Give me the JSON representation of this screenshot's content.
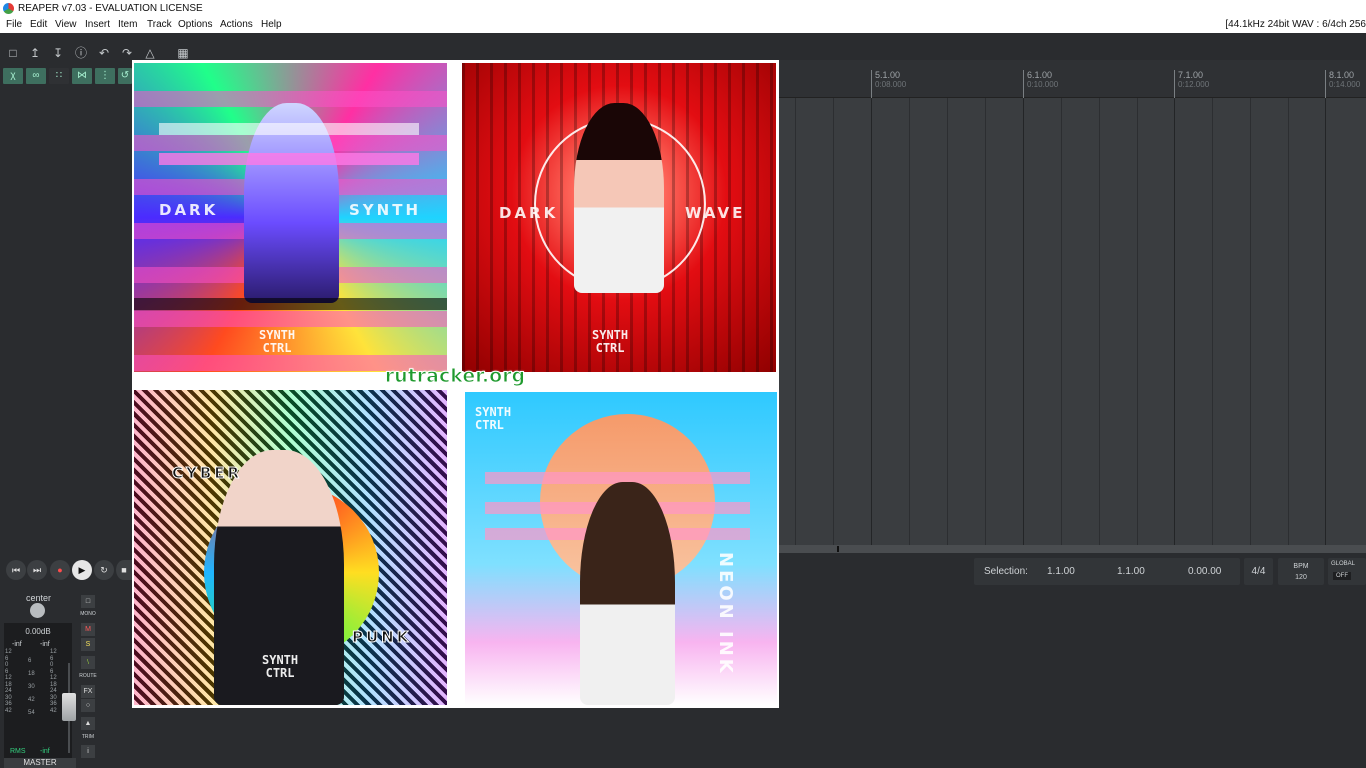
{
  "window": {
    "title": "REAPER v7.03 - EVALUATION LICENSE",
    "audio_status": "[44.1kHz 24bit WAV : 6/4ch 256"
  },
  "menu": [
    "File",
    "Edit",
    "View",
    "Insert",
    "Item",
    "Track",
    "Options",
    "Actions",
    "Help"
  ],
  "timeline": {
    "markers": [
      {
        "bar": "5.1.00",
        "time": "0:08.000"
      },
      {
        "bar": "6.1.00",
        "time": "0:10.000"
      },
      {
        "bar": "7.1.00",
        "time": "0:12.000"
      },
      {
        "bar": "8.1.00",
        "time": "0:14.000"
      }
    ]
  },
  "transport": {
    "selection_label": "Selection:",
    "selection_start": "1.1.00",
    "selection_end": "1.1.00",
    "selection_length": "0.00.00",
    "time_signature": "4/4",
    "bpm_label": "BPM",
    "bpm_value": "120",
    "global_label": "GLOBAL",
    "global_state": "OFF"
  },
  "master": {
    "pan": "center",
    "volume": "0.00dB",
    "peak_left": "-inf",
    "peak_right": "-inf",
    "scale_left": [
      "12",
      "6",
      "0",
      "6",
      "12",
      "18",
      "24",
      "30",
      "36",
      "42"
    ],
    "scale_mid_left": [
      "6",
      "18",
      "30",
      "42",
      "54"
    ],
    "scale_mid_right": [
      "12",
      "6",
      "0",
      "6",
      "12",
      "18",
      "24",
      "30",
      "36",
      "42"
    ],
    "rms_label": "RMS",
    "rms_value": "-inf",
    "label": "MASTER",
    "buttons": {
      "mono": "MONO",
      "mute": "M",
      "solo": "S",
      "route": "ROUTE",
      "fx": "FX",
      "trim": "TRIM",
      "info": "i"
    }
  },
  "covers": {
    "dark_synth": {
      "left_word": "DARK",
      "right_word": "SYNTH",
      "brand_line1": "SYNTH",
      "brand_line2": "CTRL"
    },
    "dark_wave": {
      "left_word": "DARK",
      "right_word": "WAVE",
      "brand_line1": "SYNTH",
      "brand_line2": "CTRL"
    },
    "cyber_punk": {
      "top_word": "CYBER",
      "bottom_word": "PUNK",
      "brand_line1": "SYNTH",
      "brand_line2": "CTRL"
    },
    "neon": {
      "brand_line1": "SYNTH",
      "brand_line2": "CTRL",
      "side_text": "NEON INK"
    }
  },
  "watermark": "rutracker.org",
  "icons": [
    "new-project-icon",
    "open-project-icon",
    "save-project-icon",
    "project-settings-icon",
    "undo-icon",
    "redo-icon",
    "metronome-icon",
    "grid-icon"
  ],
  "colors": {
    "accent_green": "#3e6f5f",
    "record_red": "#ff4c4c",
    "watermark_green": "#1f9a2e"
  }
}
